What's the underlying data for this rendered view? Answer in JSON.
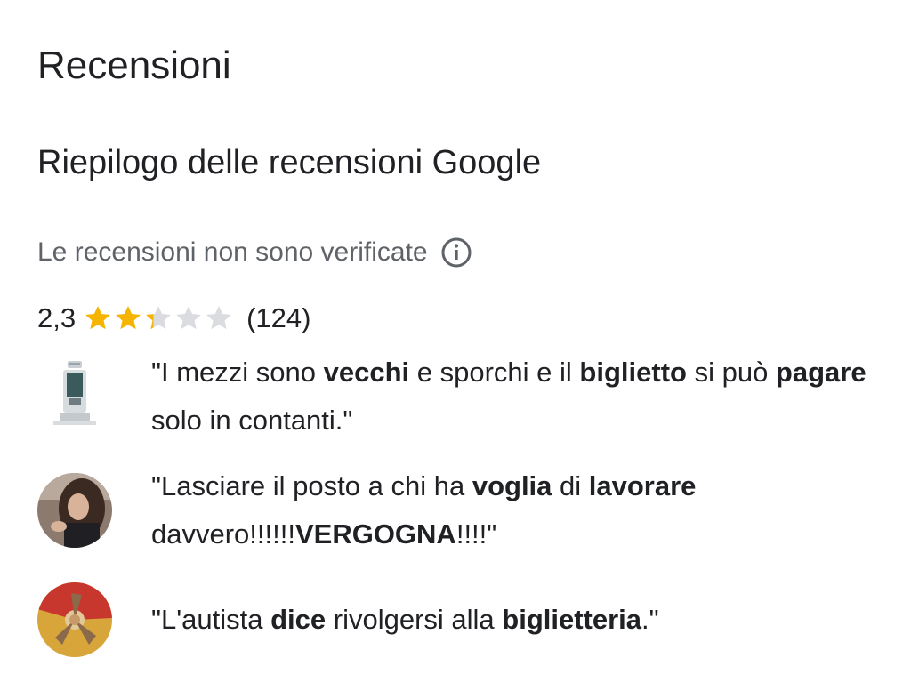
{
  "header": {
    "title": "Recensioni",
    "summary_title": "Riepilogo delle recensioni Google",
    "unverified_notice": "Le recensioni non sono verificate",
    "info_icon": "info-icon"
  },
  "rating": {
    "value_text": "2,3",
    "value": 2.3,
    "max": 5,
    "count_text": "(124)",
    "star_color": "#f4b400",
    "empty_star_color": "#dadce0"
  },
  "reviews": [
    {
      "avatar": "ticket-machine-photo",
      "segments": [
        {
          "t": "\"I mezzi sono ",
          "b": false
        },
        {
          "t": "vecchi",
          "b": true
        },
        {
          "t": " e sporchi e il ",
          "b": false
        },
        {
          "t": "biglietto",
          "b": true
        },
        {
          "t": " si può ",
          "b": false
        },
        {
          "t": "pagare",
          "b": true
        },
        {
          "t": " solo in contanti.\"",
          "b": false
        }
      ]
    },
    {
      "avatar": "user-avatar-photo",
      "segments": [
        {
          "t": "\"Lasciare il posto a chi ha ",
          "b": false
        },
        {
          "t": "voglia",
          "b": true
        },
        {
          "t": " di ",
          "b": false
        },
        {
          "t": "lavorare",
          "b": true
        },
        {
          "t": " davvero!!!!!!",
          "b": false
        },
        {
          "t": "VERGOGNA",
          "b": true
        },
        {
          "t": "!!!!\"",
          "b": false
        }
      ]
    },
    {
      "avatar": "trinacria-avatar",
      "segments": [
        {
          "t": "\"L'autista ",
          "b": false
        },
        {
          "t": "dice",
          "b": true
        },
        {
          "t": " rivolgersi alla ",
          "b": false
        },
        {
          "t": "biglietteria",
          "b": true
        },
        {
          "t": ".\"",
          "b": false
        }
      ]
    }
  ]
}
